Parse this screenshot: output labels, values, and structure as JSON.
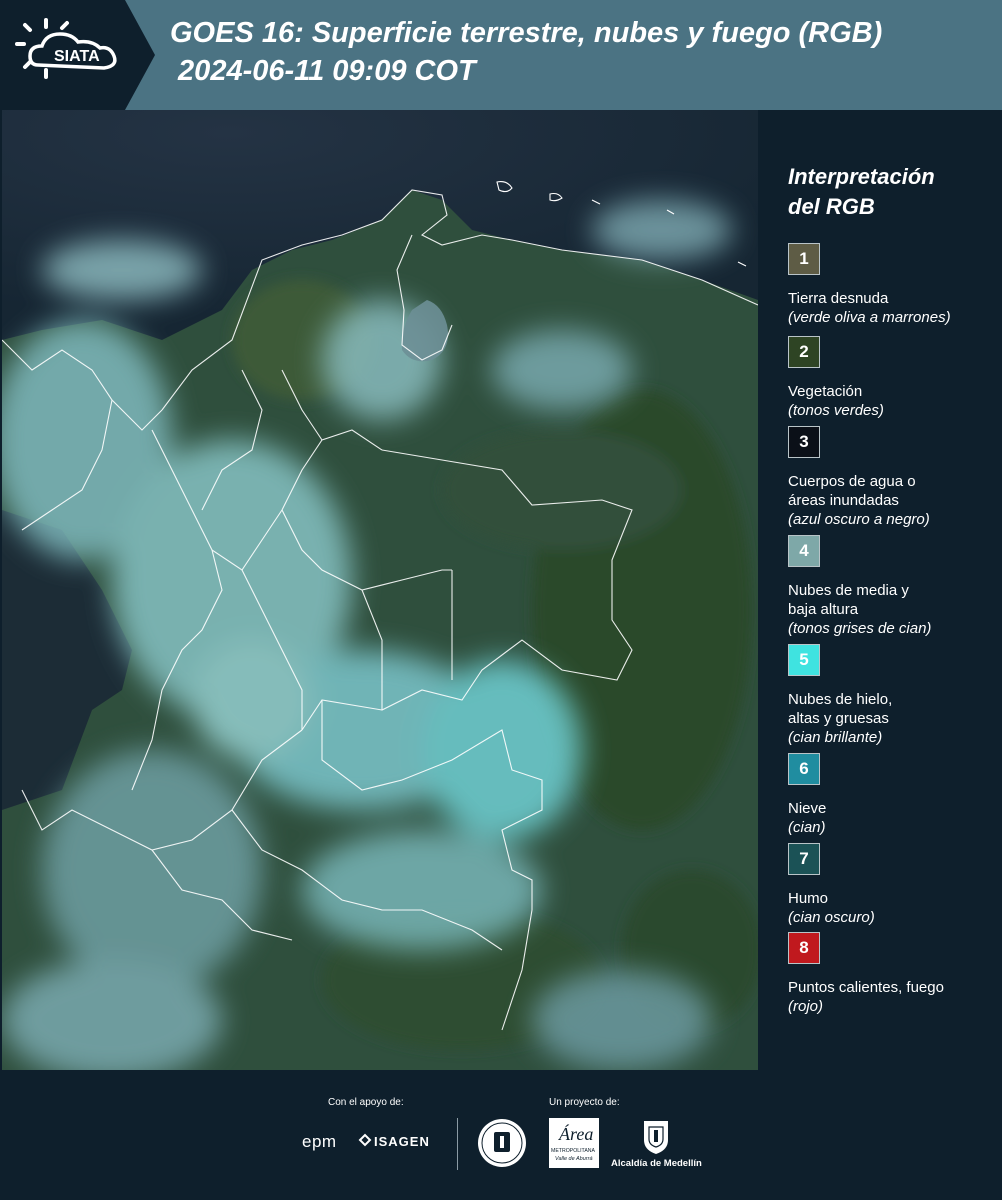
{
  "header": {
    "logo_text": "SIATA",
    "title_line1": "GOES 16: Superficie terrestre, nubes y fuego (RGB)",
    "title_line2": " 2024-06-11 09:09 COT"
  },
  "legend": {
    "title_line1": "Interpretación",
    "title_line2": "del RGB",
    "items": [
      {
        "number": "1",
        "color": "#5e5c45",
        "label_lines": [
          "Tierra desnuda"
        ],
        "sub": "(verde oliva a marrones)"
      },
      {
        "number": "2",
        "color": "#2e4424",
        "label_lines": [
          "Vegetación"
        ],
        "sub": "(tonos verdes)"
      },
      {
        "number": "3",
        "color": "#0b1018",
        "label_lines": [
          "Cuerpos de agua o",
          "áreas inundadas"
        ],
        "sub": "(azul oscuro a negro)"
      },
      {
        "number": "4",
        "color": "#7ea8a8",
        "label_lines": [
          "Nubes de media y",
          "baja altura"
        ],
        "sub": "(tonos grises de cian)"
      },
      {
        "number": "5",
        "color": "#3fe3e0",
        "label_lines": [
          "Nubes de hielo,",
          "altas y gruesas"
        ],
        "sub": "(cian brillante)"
      },
      {
        "number": "6",
        "color": "#208da0",
        "label_lines": [
          "Nieve"
        ],
        "sub": "(cian)"
      },
      {
        "number": "7",
        "color": "#1b5256",
        "label_lines": [
          "Humo"
        ],
        "sub": "(cian oscuro)"
      },
      {
        "number": "8",
        "color": "#c0191e",
        "label_lines": [
          "Puntos calientes, fuego"
        ],
        "sub": "(rojo)"
      }
    ]
  },
  "footer": {
    "support_label": "Con el apoyo de:",
    "project_label": "Un proyecto de:",
    "sponsor_epm": "epm",
    "sponsor_isagen": "ISAGEN",
    "area_logo_word": "Área",
    "area_logo_text1": "METROPOLITANA",
    "area_logo_text2": "Valle de Aburrá",
    "alcaldia": "Alcaldía de Medellín"
  }
}
